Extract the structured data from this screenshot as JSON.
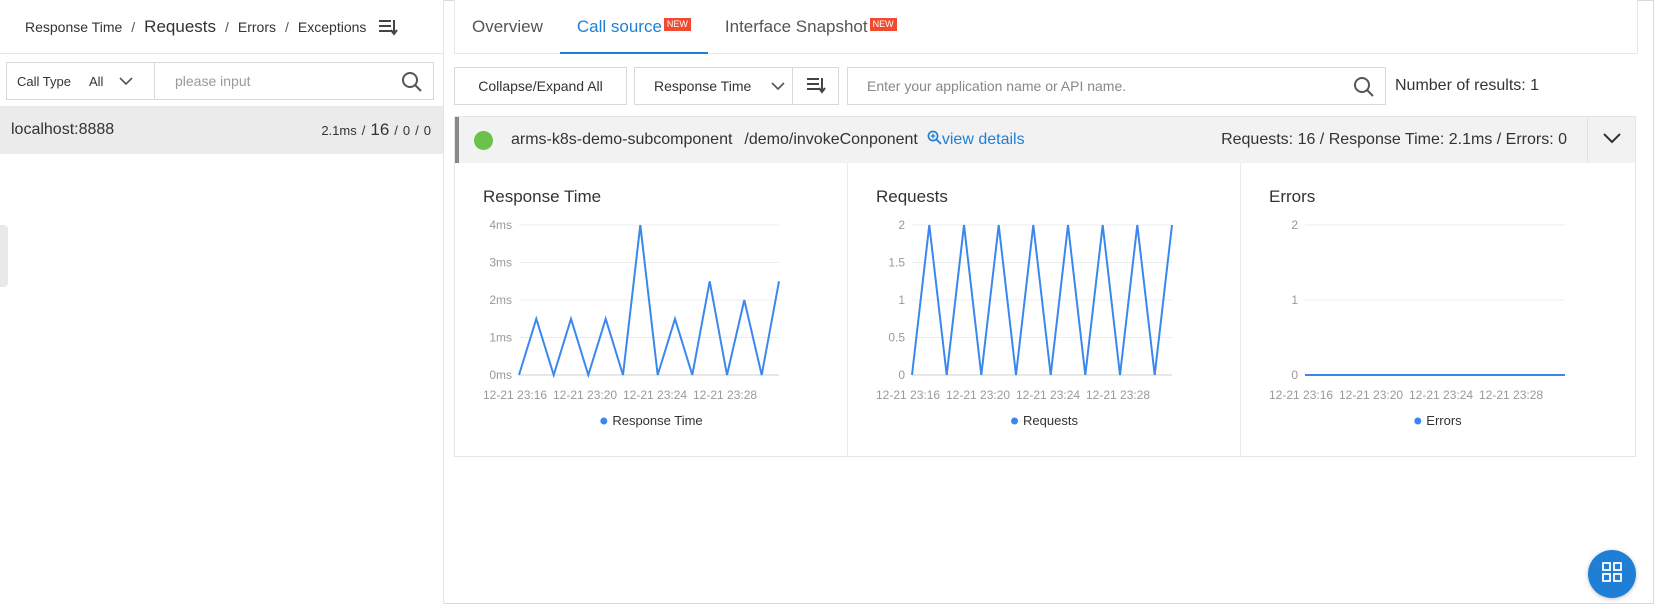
{
  "left_panel": {
    "sort_options": [
      "Response Time",
      "Requests",
      "Errors",
      "Exceptions"
    ],
    "sort_active_index": 1,
    "filter": {
      "label": "Call Type",
      "value": "All",
      "search_placeholder": "please input"
    },
    "hosts": [
      {
        "name": "localhost:8888",
        "response_time": "2.1ms",
        "requests": "16",
        "errors": "0",
        "exceptions": "0"
      }
    ]
  },
  "tabs": [
    {
      "label": "Overview",
      "new": false
    },
    {
      "label": "Call source",
      "new": true
    },
    {
      "label": "Interface Snapshot",
      "new": true
    }
  ],
  "active_tab_index": 1,
  "new_badge_text": "NEW",
  "toolbar": {
    "collapse_label": "Collapse/Expand All",
    "sort_select_value": "Response Time",
    "search_placeholder": "Enter your application name or API name.",
    "results_label": "Number of results: 1"
  },
  "service": {
    "name": "arms-k8s-demo-subcomponent",
    "path": "/demo/invokeConponent",
    "view_details_label": "view details",
    "stats_text": "Requests: 16 / Response Time: 2.1ms / Errors: 0",
    "status_color": "#6bc24a"
  },
  "colors": {
    "accent": "#1f7fd6",
    "series": "#3b87f0",
    "badge": "#f04b31"
  },
  "icons": {
    "sort": "sort-icon",
    "search": "search-icon",
    "chevron": "chevron-down-icon",
    "zoom": "zoom-in-icon",
    "fab": "grid-icon"
  },
  "chart_data": [
    {
      "type": "line",
      "title": "Response Time",
      "x_tick_labels": [
        "12-21 23:16",
        "12-21 23:20",
        "12-21 23:24",
        "12-21 23:28"
      ],
      "x": [
        0,
        1,
        2,
        3,
        4,
        5,
        6,
        7,
        8,
        9,
        10,
        11,
        12,
        13,
        14,
        15,
        16,
        17
      ],
      "y_tick_labels": [
        "0ms",
        "1ms",
        "2ms",
        "3ms",
        "4ms"
      ],
      "ylim": [
        0,
        4
      ],
      "series": [
        {
          "name": "Response Time",
          "values": [
            0,
            1.5,
            0,
            1.5,
            0,
            1.5,
            0,
            4,
            0,
            1.5,
            0,
            2.5,
            0,
            2,
            0,
            2.5
          ]
        }
      ]
    },
    {
      "type": "line",
      "title": "Requests",
      "x_tick_labels": [
        "12-21 23:16",
        "12-21 23:20",
        "12-21 23:24",
        "12-21 23:28"
      ],
      "y_tick_labels": [
        "0",
        "0.5",
        "1",
        "1.5",
        "2"
      ],
      "ylim": [
        0,
        2
      ],
      "series": [
        {
          "name": "Requests",
          "values": [
            0,
            2,
            0,
            2,
            0,
            2,
            0,
            2,
            0,
            2,
            0,
            2,
            0,
            2,
            0,
            2
          ]
        }
      ]
    },
    {
      "type": "line",
      "title": "Errors",
      "x_tick_labels": [
        "12-21 23:16",
        "12-21 23:20",
        "12-21 23:24",
        "12-21 23:28"
      ],
      "y_tick_labels": [
        "0",
        "1",
        "2"
      ],
      "ylim": [
        0,
        2
      ],
      "series": [
        {
          "name": "Errors",
          "values": [
            0,
            0,
            0,
            0,
            0,
            0,
            0,
            0,
            0,
            0,
            0,
            0,
            0,
            0,
            0,
            0
          ]
        }
      ]
    }
  ]
}
